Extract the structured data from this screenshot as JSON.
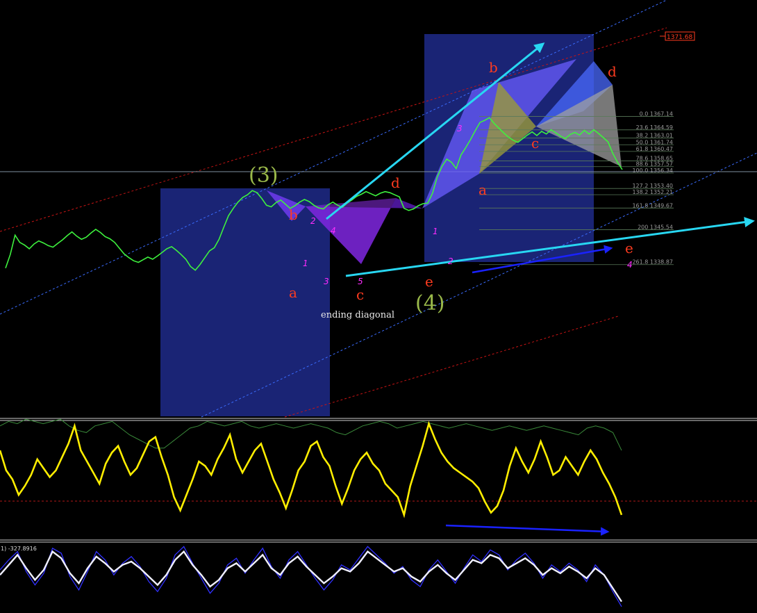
{
  "price_tag": "1371.68",
  "fib_levels": [
    {
      "ratio": "0.0",
      "price": "1367.14"
    },
    {
      "ratio": "23.6",
      "price": "1364.59"
    },
    {
      "ratio": "38.2",
      "price": "1363.01"
    },
    {
      "ratio": "50.0",
      "price": "1361.74"
    },
    {
      "ratio": "61.8",
      "price": "1360.47"
    },
    {
      "ratio": "78.6",
      "price": "1358.65"
    },
    {
      "ratio": "88.6",
      "price": "1357.57"
    },
    {
      "ratio": "100.0",
      "price": "1356.34"
    },
    {
      "ratio": "127.2",
      "price": "1353.40"
    },
    {
      "ratio": "138.2",
      "price": "1352.21"
    },
    {
      "ratio": "161.8",
      "price": "1349.67"
    },
    {
      "ratio": "200",
      "price": "1345.54"
    },
    {
      "ratio": "261.8",
      "price": "1338.87"
    }
  ],
  "wave_labels": {
    "deg3": "(3)",
    "deg4": "(4)",
    "a1": "a",
    "b1": "b",
    "c1": "c",
    "d1": "d",
    "e1": "e",
    "a2": "a",
    "b2": "b",
    "c2": "c",
    "d2": "d",
    "e2": "e",
    "n1": "1",
    "n2": "2",
    "n3": "3",
    "n4": "4",
    "n5": "5",
    "m1": "1",
    "m2": "2",
    "m3": "3",
    "m4": "4"
  },
  "annotation": "ending diagonal",
  "indicator_label": "1) -327.8916",
  "chart_data": {
    "type": "line",
    "title": "",
    "series": [
      {
        "values": [
          1338.2,
          1340.8,
          1344.5,
          1343.1,
          1342.6,
          1341.9,
          1342.8,
          1343.4,
          1343.0,
          1342.5,
          1342.2,
          1342.9,
          1343.6,
          1344.4,
          1345.1,
          1344.3,
          1343.7,
          1344.1,
          1344.9,
          1345.6,
          1345.0,
          1344.2,
          1343.8,
          1343.1,
          1342.0,
          1340.9,
          1340.2,
          1339.6,
          1339.3,
          1339.8,
          1340.3,
          1339.9,
          1340.5,
          1341.2,
          1341.9,
          1342.3,
          1341.6,
          1340.8,
          1339.9,
          1338.5,
          1337.8,
          1338.9,
          1340.2,
          1341.5,
          1342.1,
          1343.7,
          1346.0,
          1348.2,
          1349.6,
          1350.8,
          1351.7,
          1352.2,
          1353.0,
          1352.6,
          1351.5,
          1350.2,
          1349.9,
          1350.7,
          1351.2,
          1350.4,
          1349.6,
          1350.1,
          1350.8,
          1351.3,
          1350.9,
          1350.2,
          1349.7,
          1349.5,
          1350.3,
          1350.8,
          1350.2,
          1349.8,
          1350.6,
          1351.2,
          1351.9,
          1352.3,
          1352.8,
          1352.4,
          1352.0,
          1352.5,
          1352.8,
          1352.6,
          1352.2,
          1351.8,
          1349.6,
          1349.2,
          1349.5,
          1350.1,
          1350.5,
          1350.6,
          1352.5,
          1355.6,
          1357.6,
          1359.0,
          1358.4,
          1357.2,
          1359.8,
          1361.2,
          1362.7,
          1364.4,
          1366.0,
          1366.4,
          1366.9,
          1365.8,
          1364.9,
          1364.0,
          1363.2,
          1362.6,
          1362.2,
          1362.9,
          1363.6,
          1364.2,
          1363.5,
          1364.3,
          1363.8,
          1364.6,
          1364.0,
          1363.4,
          1362.9,
          1363.7,
          1364.1,
          1363.6,
          1364.5,
          1363.8,
          1364.6,
          1363.9,
          1363.1,
          1362.3,
          1360.1,
          1358.4,
          1357.0
        ]
      },
      {
        "values": [
          3.5,
          2.6,
          2.2,
          1.5,
          1.9,
          2.4,
          3.1,
          2.7,
          2.3,
          2.6,
          3.2,
          3.8,
          4.6,
          3.5,
          3.0,
          2.5,
          2.0,
          2.9,
          3.4,
          3.7,
          3.0,
          2.4,
          2.7,
          3.3,
          3.9,
          4.1,
          3.2,
          2.4,
          1.4,
          0.8,
          1.5,
          2.2,
          3.0,
          2.8,
          2.4,
          3.1,
          3.6,
          4.2,
          3.1,
          2.5,
          3.0,
          3.5,
          3.8,
          3.0,
          2.2,
          1.6,
          0.9,
          1.7,
          2.6,
          3.0,
          3.7,
          3.9,
          3.2,
          2.8,
          1.9,
          1.1,
          1.8,
          2.6,
          3.1,
          3.4,
          2.9,
          2.6,
          2.0,
          1.7,
          1.4,
          0.6,
          1.9,
          2.8,
          3.7,
          4.7,
          4.0,
          3.4,
          3.0,
          2.7,
          2.5,
          2.3,
          2.1,
          1.8,
          1.2,
          0.7,
          1.0,
          1.7,
          2.8,
          3.6,
          3.0,
          2.5,
          3.1,
          3.9,
          3.2,
          2.4,
          2.6,
          3.2,
          2.8,
          2.4,
          3.0,
          3.5,
          3.1,
          2.5,
          2.0,
          1.4,
          0.6
        ]
      },
      {
        "values": [
          4.6,
          4.8,
          4.7,
          4.9,
          4.8,
          4.7,
          4.8,
          4.9,
          4.6,
          4.4,
          4.3,
          4.6,
          4.7,
          4.8,
          4.5,
          4.2,
          4.0,
          3.8,
          3.6,
          3.6,
          3.9,
          4.2,
          4.5,
          4.6,
          4.8,
          4.7,
          4.6,
          4.7,
          4.8,
          4.6,
          4.5,
          4.6,
          4.7,
          4.6,
          4.5,
          4.6,
          4.7,
          4.6,
          4.5,
          4.3,
          4.2,
          4.4,
          4.6,
          4.7,
          4.8,
          4.7,
          4.5,
          4.6,
          4.7,
          4.8,
          4.7,
          4.6,
          4.5,
          4.6,
          4.7,
          4.6,
          4.5,
          4.4,
          4.5,
          4.6,
          4.5,
          4.4,
          4.5,
          4.6,
          4.5,
          4.4,
          4.3,
          4.2,
          4.5,
          4.6,
          4.5,
          4.3,
          3.5
        ]
      },
      {
        "values": [
          2.2,
          2.8,
          3.4,
          2.6,
          1.9,
          2.5,
          3.6,
          3.2,
          2.3,
          1.7,
          2.6,
          3.3,
          2.9,
          2.4,
          2.8,
          3.0,
          2.6,
          2.1,
          1.6,
          2.2,
          3.1,
          3.6,
          2.8,
          2.2,
          1.5,
          1.9,
          2.6,
          2.9,
          2.4,
          2.9,
          3.4,
          2.6,
          2.2,
          2.9,
          3.3,
          2.7,
          2.2,
          1.7,
          2.1,
          2.6,
          2.4,
          2.9,
          3.6,
          3.2,
          2.8,
          2.4,
          2.6,
          2.1,
          1.8,
          2.4,
          2.8,
          2.3,
          1.9,
          2.5,
          3.1,
          2.9,
          3.4,
          3.2,
          2.6,
          2.9,
          3.2,
          2.8,
          2.2,
          2.6,
          2.3,
          2.7,
          2.4,
          2.0,
          2.6,
          2.2,
          1.4,
          0.6
        ]
      },
      {
        "values": [
          2.5,
          3.1,
          3.6,
          2.4,
          1.6,
          2.3,
          3.8,
          3.5,
          2.1,
          1.3,
          2.4,
          3.6,
          3.1,
          2.2,
          2.9,
          3.3,
          2.7,
          1.8,
          1.2,
          2.0,
          3.4,
          3.9,
          2.9,
          2.0,
          1.1,
          1.7,
          2.8,
          3.2,
          2.3,
          3.1,
          3.8,
          2.7,
          2.0,
          3.1,
          3.6,
          2.8,
          2.0,
          1.3,
          1.9,
          2.8,
          2.5,
          3.2,
          3.9,
          3.4,
          2.9,
          2.3,
          2.7,
          1.9,
          1.5,
          2.5,
          3.1,
          2.4,
          1.7,
          2.6,
          3.4,
          3.0,
          3.7,
          3.4,
          2.5,
          3.1,
          3.5,
          2.9,
          2.0,
          2.8,
          2.4,
          2.9,
          2.5,
          1.8,
          2.8,
          2.2,
          1.2,
          0.3
        ]
      }
    ]
  }
}
